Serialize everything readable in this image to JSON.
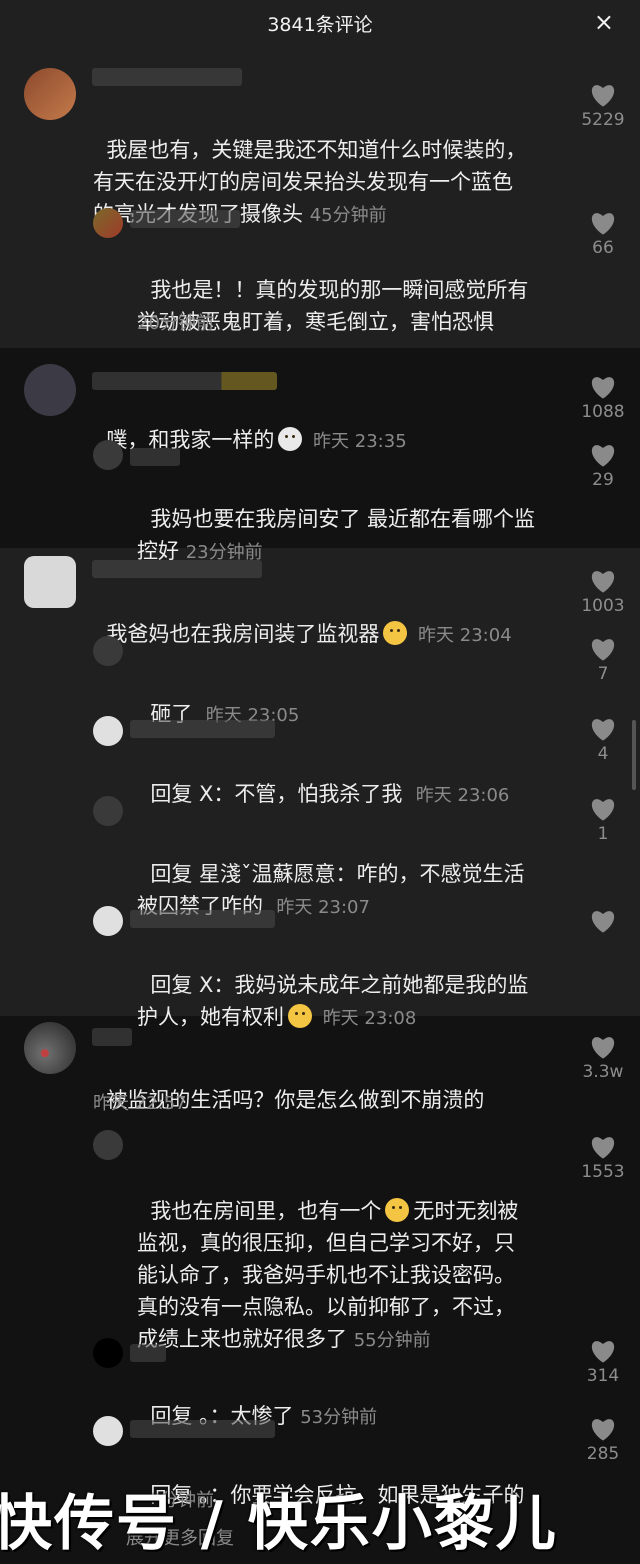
{
  "header": {
    "title": "3841条评论",
    "close_icon": "×"
  },
  "comments": [
    {
      "text": "我屋也有，关键是我还不知道什么时候装的，\n有天在没开灯的房间发呆抬头发现有一个蓝色\n的亮光才发现了摄像头",
      "time": "45分钟前",
      "likes": "5229"
    },
    {
      "text": "我也是！！真的发现的那一瞬间感觉所有\n举动被恶鬼盯着，寒毛倒立，害怕恐惧",
      "time": "20分钟前",
      "likes": "66"
    },
    {
      "text": "噗，和我家一样的",
      "time": "昨天 23:35",
      "likes": "1088"
    },
    {
      "text": "我妈也要在我房间安了 最近都在看哪个监\n控好",
      "time": "23分钟前",
      "likes": "29"
    },
    {
      "text": "我爸妈也在我房间装了监视器",
      "time": "昨天 23:04",
      "likes": "1003"
    },
    {
      "text": "砸了",
      "time": "昨天 23:05",
      "likes": "7"
    },
    {
      "text": "回复 X：不管，怕我杀了我",
      "time": "昨天 23:06",
      "likes": "4"
    },
    {
      "text": "回复 星淺ˇ温蘇愿意：咋的，不感觉生活\n被囚禁了咋的",
      "time": "昨天 23:07",
      "likes": "1"
    },
    {
      "text": "回复 X：我妈说未成年之前她都是我的监\n护人，她有权利",
      "time": "昨天 23:08",
      "likes": ""
    },
    {
      "text": "被监视的生活吗？你是怎么做到不崩溃的",
      "time": "昨天 22:57",
      "likes": "3.3w"
    },
    {
      "text": "我也在房间里，也有一个",
      "text2": "无时无刻被\n监视，真的很压抑，但自己学习不好，只\n能认命了，我爸妈手机也不让我设密码。\n真的没有一点隐私。以前抑郁了，不过，\n成绩上来也就好很多了",
      "time": "55分钟前",
      "likes": "1553"
    },
    {
      "text": "回复 。：太惨了",
      "time": "53分钟前",
      "likes": "314"
    },
    {
      "text": "回复 。：你要学会反抗，如果是独生子的",
      "time": "分钟前",
      "likes": "285"
    }
  ],
  "expand_more": "展开更多回复",
  "watermark": "快传号 / 快乐小黎儿",
  "colors": {
    "bg": "#202020",
    "dark_band": "#121212",
    "text": "#ededed",
    "meta": "#8a8a8a"
  }
}
